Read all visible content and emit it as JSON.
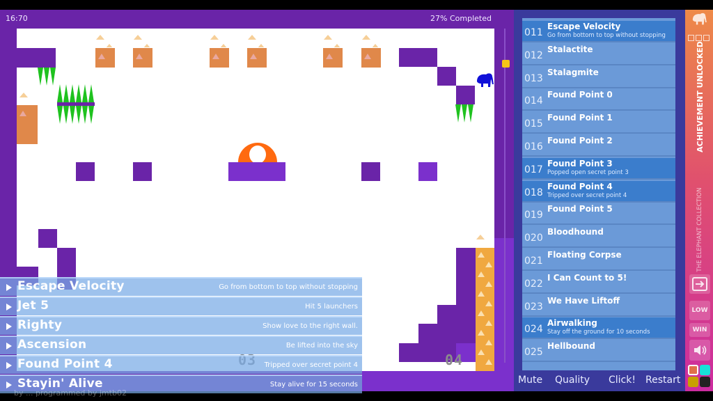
{
  "hud": {
    "time": "16:70",
    "progress_label": "27% Completed",
    "progress_percent": 27
  },
  "level": {
    "room_labels": [
      "03",
      "04"
    ],
    "player_icon": "elephant-icon",
    "colors": {
      "wall": "#6a24a8",
      "wall_light": "#7b30cc",
      "spike": "#1fc21f",
      "crate": "#e0884a",
      "launcher": "#f0a840",
      "goal": "#ff6a10",
      "player": "#1010d8",
      "scroll_thumb": "#f5c518"
    }
  },
  "toasts": [
    {
      "title": "Escape Velocity",
      "desc": "Go from bottom to top without stopping"
    },
    {
      "title": "Jet 5",
      "desc": "Hit 5 launchers"
    },
    {
      "title": "Righty",
      "desc": "Show love to the right wall."
    },
    {
      "title": "Ascension",
      "desc": "Be lifted into the sky"
    },
    {
      "title": "Found Point 4",
      "desc": "Tripped over secret point 4"
    },
    {
      "title": "Stayin' Alive",
      "desc": "Stay alive for 15 seconds"
    }
  ],
  "credit": "by ... programmed by jmtb02",
  "achievements": [
    {
      "num": "011",
      "title": "Escape Velocity",
      "desc": "Go from bottom to top without stopping",
      "unlocked": true
    },
    {
      "num": "012",
      "title": "Stalactite",
      "desc": "",
      "unlocked": false
    },
    {
      "num": "013",
      "title": "Stalagmite",
      "desc": "",
      "unlocked": false
    },
    {
      "num": "014",
      "title": "Found Point 0",
      "desc": "",
      "unlocked": false
    },
    {
      "num": "015",
      "title": "Found Point 1",
      "desc": "",
      "unlocked": false
    },
    {
      "num": "016",
      "title": "Found Point 2",
      "desc": "",
      "unlocked": false
    },
    {
      "num": "017",
      "title": "Found Point 3",
      "desc": "Popped open secret point 3",
      "unlocked": true
    },
    {
      "num": "018",
      "title": "Found Point 4",
      "desc": "Tripped over secret point 4",
      "unlocked": true
    },
    {
      "num": "019",
      "title": "Found Point 5",
      "desc": "",
      "unlocked": false
    },
    {
      "num": "020",
      "title": "Bloodhound",
      "desc": "",
      "unlocked": false
    },
    {
      "num": "021",
      "title": "Floating Corpse",
      "desc": "",
      "unlocked": false
    },
    {
      "num": "022",
      "title": "I Can Count to 5!",
      "desc": "",
      "unlocked": false
    },
    {
      "num": "023",
      "title": "We Have Liftoff",
      "desc": "",
      "unlocked": false
    },
    {
      "num": "024",
      "title": "Airwalking",
      "desc": "Stay off the ground for 10 seconds",
      "unlocked": true
    },
    {
      "num": "025",
      "title": "Hellbound",
      "desc": "",
      "unlocked": false
    }
  ],
  "controls": {
    "mute": "Mute",
    "quality": "Quality",
    "click": "Click!",
    "restart": "Restart"
  },
  "sidebar": {
    "achievement_banner": "ACHIEVEMENT UNLOCKED",
    "collection_label": "THE ELEPHANT COLLECTION",
    "quality_low": "LOW",
    "win": "WIN",
    "swatches": [
      "#e0704a",
      "#18e0d8",
      "#c8a000",
      "#222222"
    ]
  }
}
